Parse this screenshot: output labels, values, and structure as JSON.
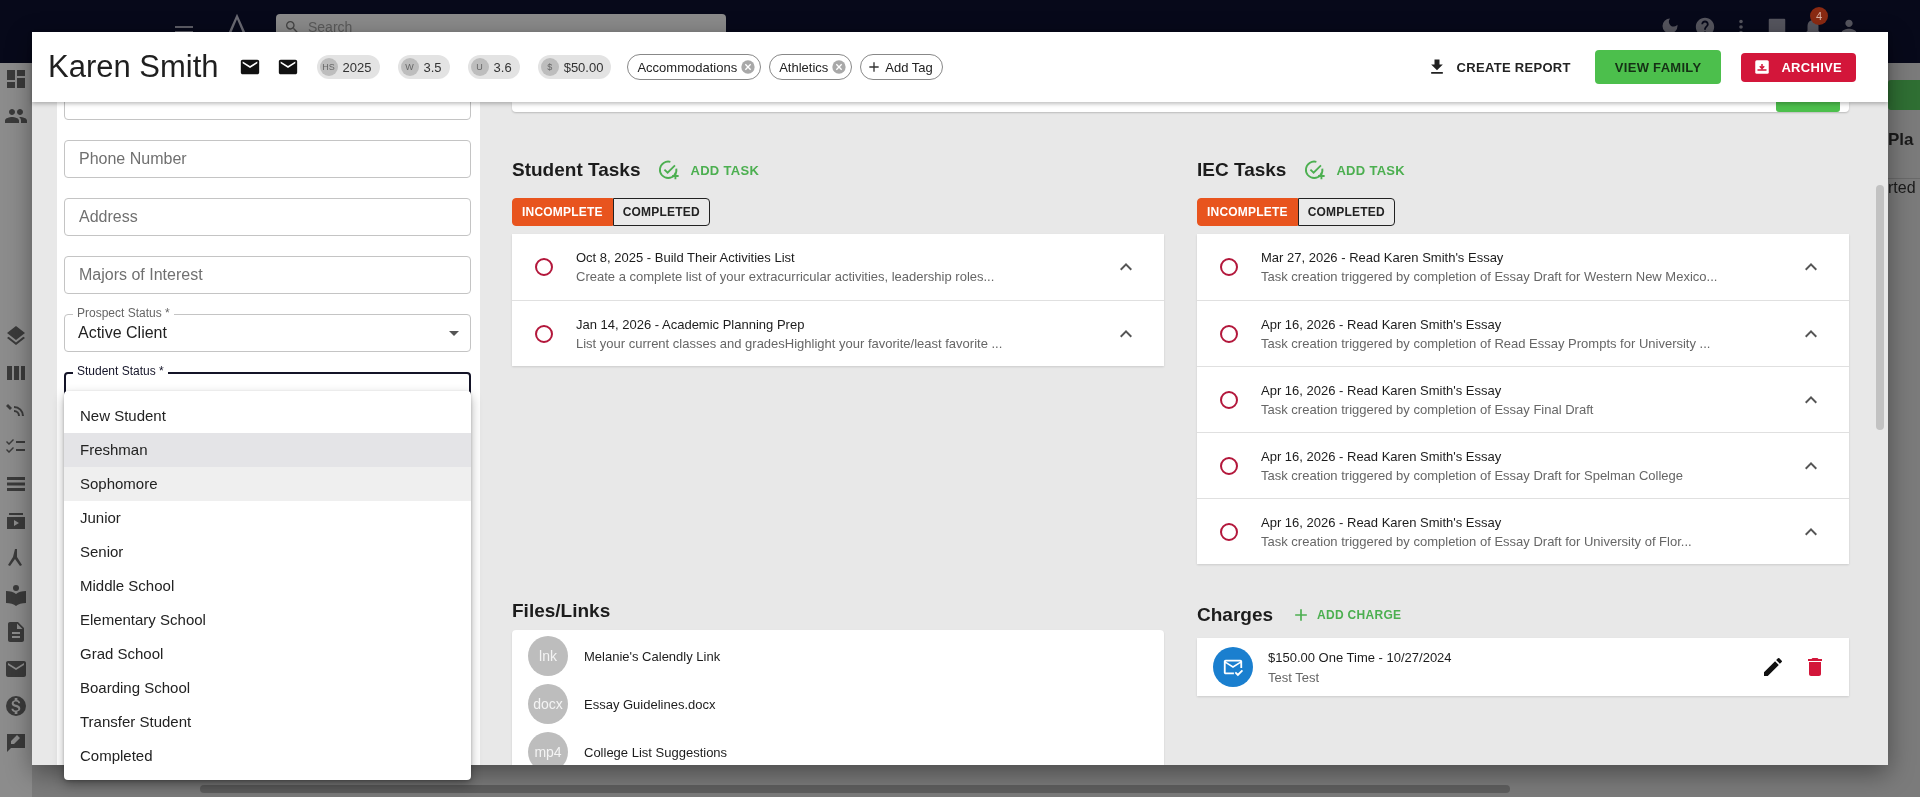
{
  "background": {
    "search": {
      "placeholder": "Search"
    },
    "notification_count": "4",
    "side_texts": [
      "Pla",
      "rted"
    ]
  },
  "header": {
    "name": "Karen Smith",
    "stats": [
      {
        "badge": "HS",
        "value": "2025"
      },
      {
        "badge": "W",
        "value": "3.5"
      },
      {
        "badge": "U",
        "value": "3.6"
      },
      {
        "badge": "$",
        "value": "$50.00"
      }
    ],
    "tags": [
      "Accommodations",
      "Athletics"
    ],
    "add_tag": "Add Tag",
    "actions": [
      {
        "kind": "text",
        "label": "CREATE REPORT"
      },
      {
        "kind": "green",
        "label": "VIEW FAMILY"
      },
      {
        "kind": "red",
        "label": "ARCHIVE"
      }
    ]
  },
  "form": {
    "fields": [
      {
        "kind": "text"
      },
      {
        "kind": "text",
        "placeholder": "Phone Number"
      },
      {
        "kind": "text",
        "placeholder": "Address"
      },
      {
        "kind": "text",
        "placeholder": "Majors of Interest"
      },
      {
        "kind": "select",
        "label": "Prospect Status *",
        "value": "Active Client",
        "focused": false
      },
      {
        "kind": "select",
        "label": "Student Status *",
        "focused": true
      }
    ],
    "menu": [
      {
        "label": "New Student",
        "selected": false,
        "highlighted": false
      },
      {
        "label": "Freshman",
        "selected": true,
        "highlighted": false
      },
      {
        "label": "Sophomore",
        "selected": false,
        "highlighted": true
      },
      {
        "label": "Junior",
        "selected": false,
        "highlighted": false
      },
      {
        "label": "Senior",
        "selected": false,
        "highlighted": false
      },
      {
        "label": "Middle School",
        "selected": false,
        "highlighted": false
      },
      {
        "label": "Elementary School",
        "selected": false,
        "highlighted": false
      },
      {
        "label": "Grad School",
        "selected": false,
        "highlighted": false
      },
      {
        "label": "Boarding School",
        "selected": false,
        "highlighted": false
      },
      {
        "label": "Transfer Student",
        "selected": false,
        "highlighted": false
      },
      {
        "label": "Completed",
        "selected": false,
        "highlighted": false
      }
    ]
  },
  "student_tasks": {
    "title": "Student Tasks",
    "add_label": "ADD TASK",
    "tabs": [
      {
        "label": "INCOMPLETE",
        "selected": true
      },
      {
        "label": "COMPLETED",
        "selected": false
      }
    ],
    "tasks": [
      {
        "title": "Oct 8, 2025 - Build Their Activities List",
        "description": "Create a complete list of your extracurricular activities, leadership roles...",
        "done": false
      },
      {
        "title": "Jan 14, 2026 - Academic Planning Prep",
        "description": "List your current classes and gradesHighlight your favorite/least favorite ...",
        "done": false
      }
    ]
  },
  "iec_tasks": {
    "title": "IEC Tasks",
    "add_label": "ADD TASK",
    "tabs": [
      {
        "label": "INCOMPLETE",
        "selected": true
      },
      {
        "label": "COMPLETED",
        "selected": false
      }
    ],
    "tasks": [
      {
        "title": "Mar 27, 2026 - Read Karen Smith's Essay",
        "description": "Task creation triggered by completion of Essay Draft for Western New Mexico...",
        "done": false
      },
      {
        "title": "Apr 16, 2026 - Read Karen Smith's Essay",
        "description": "Task creation triggered by completion of Read Essay Prompts for University ...",
        "done": false
      },
      {
        "title": "Apr 16, 2026 - Read Karen Smith's Essay",
        "description": "Task creation triggered by completion of Essay Final Draft",
        "done": false
      },
      {
        "title": "Apr 16, 2026 - Read Karen Smith's Essay",
        "description": "Task creation triggered by completion of Essay Draft for Spelman College",
        "done": false
      },
      {
        "title": "Apr 16, 2026 - Read Karen Smith's Essay",
        "description": "Task creation triggered by completion of Essay Draft for University of Flor...",
        "done": false
      }
    ]
  },
  "files": {
    "title": "Files/Links",
    "items": [
      {
        "type": "lnk",
        "name": "Melanie's Calendly Link"
      },
      {
        "type": "docx",
        "name": "Essay Guidelines.docx"
      },
      {
        "type": "mp4",
        "name": "College List Suggestions"
      }
    ]
  },
  "charges": {
    "title": "Charges",
    "add_label": "ADD CHARGE",
    "items": [
      {
        "title": "$150.00 One Time - 10/27/2024",
        "subtitle": "Test Test"
      }
    ]
  }
}
